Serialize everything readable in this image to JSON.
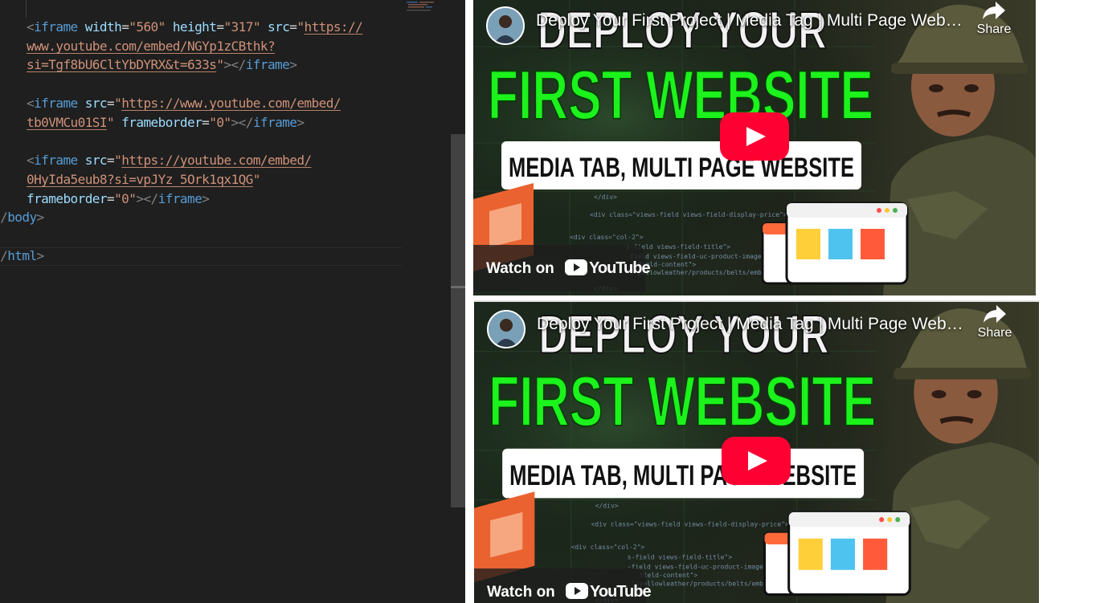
{
  "editor": {
    "lines": [
      [
        {
          "c": "tk-p",
          "t": "<"
        },
        {
          "c": "tk-t",
          "t": "iframe"
        },
        {
          "c": "tk-e",
          "t": " "
        },
        {
          "c": "tk-a",
          "t": "width"
        },
        {
          "c": "tk-e",
          "t": "="
        },
        {
          "c": "tk-s",
          "t": "\"560\""
        },
        {
          "c": "tk-e",
          "t": " "
        },
        {
          "c": "tk-a",
          "t": "height"
        },
        {
          "c": "tk-e",
          "t": "="
        },
        {
          "c": "tk-s",
          "t": "\"317\""
        },
        {
          "c": "tk-e",
          "t": " "
        },
        {
          "c": "tk-a",
          "t": "src"
        },
        {
          "c": "tk-e",
          "t": "="
        },
        {
          "c": "tk-s",
          "t": "\""
        },
        {
          "c": "tk-u",
          "t": "https://"
        }
      ],
      [
        {
          "c": "tk-u",
          "t": "www.youtube.com/embed/NGYp1zCBthk?"
        }
      ],
      [
        {
          "c": "tk-u",
          "t": "si=Tgf8bU6CltYbDYRX&t=633s"
        },
        {
          "c": "tk-s",
          "t": "\""
        },
        {
          "c": "tk-p",
          "t": "></"
        },
        {
          "c": "tk-t",
          "t": "iframe"
        },
        {
          "c": "tk-p",
          "t": ">"
        }
      ],
      [],
      [
        {
          "c": "tk-p",
          "t": "<"
        },
        {
          "c": "tk-t",
          "t": "iframe"
        },
        {
          "c": "tk-e",
          "t": " "
        },
        {
          "c": "tk-a",
          "t": "src"
        },
        {
          "c": "tk-e",
          "t": "="
        },
        {
          "c": "tk-s",
          "t": "\""
        },
        {
          "c": "tk-u",
          "t": "https://www.youtube.com/embed/"
        }
      ],
      [
        {
          "c": "tk-u",
          "t": "tb0VMCu01SI"
        },
        {
          "c": "tk-s",
          "t": "\""
        },
        {
          "c": "tk-e",
          "t": " "
        },
        {
          "c": "tk-a",
          "t": "frameborder"
        },
        {
          "c": "tk-e",
          "t": "="
        },
        {
          "c": "tk-s",
          "t": "\"0\""
        },
        {
          "c": "tk-p",
          "t": "></"
        },
        {
          "c": "tk-t",
          "t": "iframe"
        },
        {
          "c": "tk-p",
          "t": ">"
        }
      ],
      [],
      [
        {
          "c": "tk-p",
          "t": "<"
        },
        {
          "c": "tk-t",
          "t": "iframe"
        },
        {
          "c": "tk-e",
          "t": " "
        },
        {
          "c": "tk-a",
          "t": "src"
        },
        {
          "c": "tk-e",
          "t": "="
        },
        {
          "c": "tk-s",
          "t": "\""
        },
        {
          "c": "tk-u",
          "t": "https://youtube.com/embed/"
        }
      ],
      [
        {
          "c": "tk-u",
          "t": "0HyIda5eub8?si=vpJYz_5Ork1qx1QG"
        },
        {
          "c": "tk-s",
          "t": "\""
        }
      ],
      [
        {
          "c": "tk-a",
          "t": "frameborder"
        },
        {
          "c": "tk-e",
          "t": "="
        },
        {
          "c": "tk-s",
          "t": "\"0\""
        },
        {
          "c": "tk-p",
          "t": "></"
        },
        {
          "c": "tk-t",
          "t": "iframe"
        },
        {
          "c": "tk-p",
          "t": ">"
        }
      ],
      [
        {
          "c": "tk-p",
          "t": "</"
        },
        {
          "c": "tk-t",
          "t": "body"
        },
        {
          "c": "tk-p",
          "t": ">"
        }
      ],
      [],
      [
        {
          "c": "tk-p",
          "t": "</"
        },
        {
          "c": "tk-t",
          "t": "html"
        },
        {
          "c": "tk-p",
          "t": ">"
        }
      ]
    ]
  },
  "videos": [
    {
      "title": "Deploy Your First Project | Media Tag | Multi Page Website",
      "share_label": "Share",
      "watch_label": "Watch on",
      "youtube_label": "YouTube",
      "thumb": {
        "line1": "DEPLOY YOUR",
        "line2": "FIRST WEBSITE",
        "banner": "MEDIA TAB, MULTI PAGE WEBSITE"
      }
    },
    {
      "title": "Deploy Your First Project | Media Tag | Multi Page Website",
      "share_label": "Share",
      "watch_label": "Watch on",
      "youtube_label": "YouTube",
      "thumb": {
        "line1": "DEPLOY YOUR",
        "line2": "FIRST WEBSITE",
        "banner": "MEDIA TAB, MULTI PAGE WEBSITE"
      }
    }
  ],
  "colors": {
    "editor_bg": "#1f1f1f",
    "play_red": "#ff0033",
    "headline_green": "#1cf21c"
  }
}
